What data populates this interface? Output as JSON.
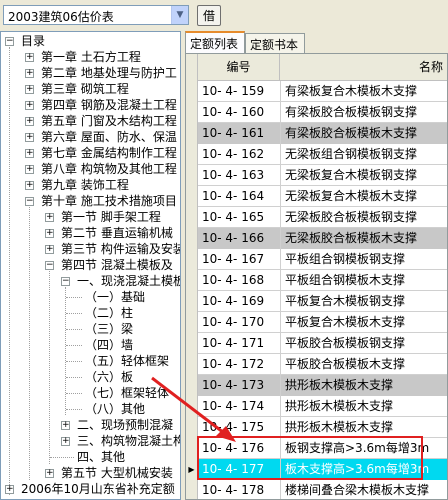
{
  "toolbar": {
    "combo_value": "2003建筑06估价表",
    "borrow_label": "借"
  },
  "tree": {
    "root": "目录",
    "chapters": [
      "第一章  土石方工程",
      "第二章  地基处理与防护工",
      "第三章  砌筑工程",
      "第四章  钢筋及混凝土工程",
      "第五章  门窗及木结构工程",
      "第六章  屋面、防水、保温",
      "第七章  金属结构制作工程",
      "第八章  构筑物及其他工程",
      "第九章  装饰工程",
      "第十章  施工技术措施项目"
    ],
    "sections": [
      "第一节  脚手架工程",
      "第二节  垂直运输机械",
      "第三节  构件运输及安装",
      "第四节  混凝土模板及"
    ],
    "subsection": "一、现浇混凝土模板",
    "items": [
      "（一）基础",
      "（二）柱",
      "（三）梁",
      "（四）墙",
      "（五）轻体框架",
      "（六）板",
      "（七）框架轻体",
      "（八）其他"
    ],
    "more": [
      "二、现场预制混凝",
      "三、构筑物混凝土构",
      "四、其他"
    ],
    "section5": "第五节  大型机械安装",
    "bottom": "2006年10月山东省补充定额"
  },
  "tabs": [
    "定额列表",
    "定额书本"
  ],
  "grid": {
    "header_code": "编号",
    "header_name": "名称",
    "rows": [
      {
        "code": "10- 4- 159",
        "name": "有梁板复合木模板木支撑"
      },
      {
        "code": "10- 4- 160",
        "name": "有梁板胶合板模板钢支撑"
      },
      {
        "code": "10- 4- 161",
        "name": "有梁板胶合板模板木支撑"
      },
      {
        "code": "10- 4- 162",
        "name": "无梁板组合钢模板钢支撑"
      },
      {
        "code": "10- 4- 163",
        "name": "无梁板复合木模板钢支撑"
      },
      {
        "code": "10- 4- 164",
        "name": "无梁板复合木模板木支撑"
      },
      {
        "code": "10- 4- 165",
        "name": "无梁板胶合板模板钢支撑"
      },
      {
        "code": "10- 4- 166",
        "name": "无梁板胶合板模板木支撑"
      },
      {
        "code": "10- 4- 167",
        "name": "平板组合钢模板钢支撑"
      },
      {
        "code": "10- 4- 168",
        "name": "平板组合钢模板木支撑"
      },
      {
        "code": "10- 4- 169",
        "name": "平板复合木模板钢支撑"
      },
      {
        "code": "10- 4- 170",
        "name": "平板复合木模板木支撑"
      },
      {
        "code": "10- 4- 171",
        "name": "平板胶合板模板钢支撑"
      },
      {
        "code": "10- 4- 172",
        "name": "平板胶合板模板木支撑"
      },
      {
        "code": "10- 4- 173",
        "name": "拱形板木模板木支撑"
      },
      {
        "code": "10- 4- 174",
        "name": "拱形板木模板木支撑"
      },
      {
        "code": "10- 4- 175",
        "name": "拱形板木模板木支撑"
      },
      {
        "code": "10- 4- 176",
        "name": "板钢支撑高>3.6m每增3m"
      },
      {
        "code": "10- 4- 177",
        "name": "板木支撑高>3.6m每增3m"
      },
      {
        "code": "10- 4- 178",
        "name": "楼梯间叠合梁木模板木支撑"
      }
    ]
  }
}
